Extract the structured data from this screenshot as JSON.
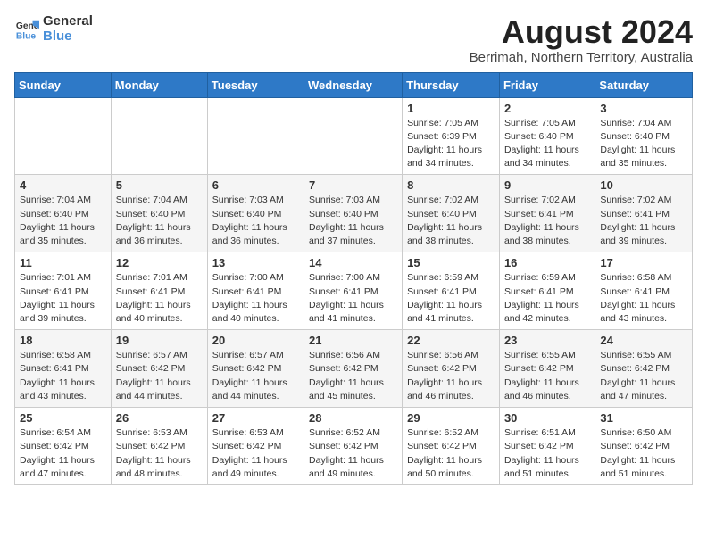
{
  "header": {
    "logo_general": "General",
    "logo_blue": "Blue",
    "month_year": "August 2024",
    "location": "Berrimah, Northern Territory, Australia"
  },
  "days_of_week": [
    "Sunday",
    "Monday",
    "Tuesday",
    "Wednesday",
    "Thursday",
    "Friday",
    "Saturday"
  ],
  "weeks": [
    [
      {
        "day": "",
        "sunrise": "",
        "sunset": "",
        "daylight": ""
      },
      {
        "day": "",
        "sunrise": "",
        "sunset": "",
        "daylight": ""
      },
      {
        "day": "",
        "sunrise": "",
        "sunset": "",
        "daylight": ""
      },
      {
        "day": "",
        "sunrise": "",
        "sunset": "",
        "daylight": ""
      },
      {
        "day": "1",
        "sunrise": "Sunrise: 7:05 AM",
        "sunset": "Sunset: 6:39 PM",
        "daylight": "Daylight: 11 hours and 34 minutes."
      },
      {
        "day": "2",
        "sunrise": "Sunrise: 7:05 AM",
        "sunset": "Sunset: 6:40 PM",
        "daylight": "Daylight: 11 hours and 34 minutes."
      },
      {
        "day": "3",
        "sunrise": "Sunrise: 7:04 AM",
        "sunset": "Sunset: 6:40 PM",
        "daylight": "Daylight: 11 hours and 35 minutes."
      }
    ],
    [
      {
        "day": "4",
        "sunrise": "Sunrise: 7:04 AM",
        "sunset": "Sunset: 6:40 PM",
        "daylight": "Daylight: 11 hours and 35 minutes."
      },
      {
        "day": "5",
        "sunrise": "Sunrise: 7:04 AM",
        "sunset": "Sunset: 6:40 PM",
        "daylight": "Daylight: 11 hours and 36 minutes."
      },
      {
        "day": "6",
        "sunrise": "Sunrise: 7:03 AM",
        "sunset": "Sunset: 6:40 PM",
        "daylight": "Daylight: 11 hours and 36 minutes."
      },
      {
        "day": "7",
        "sunrise": "Sunrise: 7:03 AM",
        "sunset": "Sunset: 6:40 PM",
        "daylight": "Daylight: 11 hours and 37 minutes."
      },
      {
        "day": "8",
        "sunrise": "Sunrise: 7:02 AM",
        "sunset": "Sunset: 6:40 PM",
        "daylight": "Daylight: 11 hours and 38 minutes."
      },
      {
        "day": "9",
        "sunrise": "Sunrise: 7:02 AM",
        "sunset": "Sunset: 6:41 PM",
        "daylight": "Daylight: 11 hours and 38 minutes."
      },
      {
        "day": "10",
        "sunrise": "Sunrise: 7:02 AM",
        "sunset": "Sunset: 6:41 PM",
        "daylight": "Daylight: 11 hours and 39 minutes."
      }
    ],
    [
      {
        "day": "11",
        "sunrise": "Sunrise: 7:01 AM",
        "sunset": "Sunset: 6:41 PM",
        "daylight": "Daylight: 11 hours and 39 minutes."
      },
      {
        "day": "12",
        "sunrise": "Sunrise: 7:01 AM",
        "sunset": "Sunset: 6:41 PM",
        "daylight": "Daylight: 11 hours and 40 minutes."
      },
      {
        "day": "13",
        "sunrise": "Sunrise: 7:00 AM",
        "sunset": "Sunset: 6:41 PM",
        "daylight": "Daylight: 11 hours and 40 minutes."
      },
      {
        "day": "14",
        "sunrise": "Sunrise: 7:00 AM",
        "sunset": "Sunset: 6:41 PM",
        "daylight": "Daylight: 11 hours and 41 minutes."
      },
      {
        "day": "15",
        "sunrise": "Sunrise: 6:59 AM",
        "sunset": "Sunset: 6:41 PM",
        "daylight": "Daylight: 11 hours and 41 minutes."
      },
      {
        "day": "16",
        "sunrise": "Sunrise: 6:59 AM",
        "sunset": "Sunset: 6:41 PM",
        "daylight": "Daylight: 11 hours and 42 minutes."
      },
      {
        "day": "17",
        "sunrise": "Sunrise: 6:58 AM",
        "sunset": "Sunset: 6:41 PM",
        "daylight": "Daylight: 11 hours and 43 minutes."
      }
    ],
    [
      {
        "day": "18",
        "sunrise": "Sunrise: 6:58 AM",
        "sunset": "Sunset: 6:41 PM",
        "daylight": "Daylight: 11 hours and 43 minutes."
      },
      {
        "day": "19",
        "sunrise": "Sunrise: 6:57 AM",
        "sunset": "Sunset: 6:42 PM",
        "daylight": "Daylight: 11 hours and 44 minutes."
      },
      {
        "day": "20",
        "sunrise": "Sunrise: 6:57 AM",
        "sunset": "Sunset: 6:42 PM",
        "daylight": "Daylight: 11 hours and 44 minutes."
      },
      {
        "day": "21",
        "sunrise": "Sunrise: 6:56 AM",
        "sunset": "Sunset: 6:42 PM",
        "daylight": "Daylight: 11 hours and 45 minutes."
      },
      {
        "day": "22",
        "sunrise": "Sunrise: 6:56 AM",
        "sunset": "Sunset: 6:42 PM",
        "daylight": "Daylight: 11 hours and 46 minutes."
      },
      {
        "day": "23",
        "sunrise": "Sunrise: 6:55 AM",
        "sunset": "Sunset: 6:42 PM",
        "daylight": "Daylight: 11 hours and 46 minutes."
      },
      {
        "day": "24",
        "sunrise": "Sunrise: 6:55 AM",
        "sunset": "Sunset: 6:42 PM",
        "daylight": "Daylight: 11 hours and 47 minutes."
      }
    ],
    [
      {
        "day": "25",
        "sunrise": "Sunrise: 6:54 AM",
        "sunset": "Sunset: 6:42 PM",
        "daylight": "Daylight: 11 hours and 47 minutes."
      },
      {
        "day": "26",
        "sunrise": "Sunrise: 6:53 AM",
        "sunset": "Sunset: 6:42 PM",
        "daylight": "Daylight: 11 hours and 48 minutes."
      },
      {
        "day": "27",
        "sunrise": "Sunrise: 6:53 AM",
        "sunset": "Sunset: 6:42 PM",
        "daylight": "Daylight: 11 hours and 49 minutes."
      },
      {
        "day": "28",
        "sunrise": "Sunrise: 6:52 AM",
        "sunset": "Sunset: 6:42 PM",
        "daylight": "Daylight: 11 hours and 49 minutes."
      },
      {
        "day": "29",
        "sunrise": "Sunrise: 6:52 AM",
        "sunset": "Sunset: 6:42 PM",
        "daylight": "Daylight: 11 hours and 50 minutes."
      },
      {
        "day": "30",
        "sunrise": "Sunrise: 6:51 AM",
        "sunset": "Sunset: 6:42 PM",
        "daylight": "Daylight: 11 hours and 51 minutes."
      },
      {
        "day": "31",
        "sunrise": "Sunrise: 6:50 AM",
        "sunset": "Sunset: 6:42 PM",
        "daylight": "Daylight: 11 hours and 51 minutes."
      }
    ]
  ]
}
